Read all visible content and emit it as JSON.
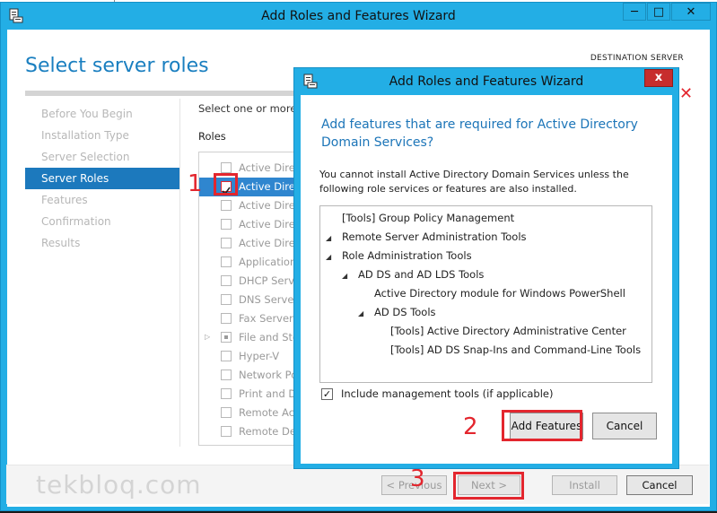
{
  "main_window": {
    "title": "Add Roles and Features Wizard",
    "heading": "Select server roles",
    "destination_label": "DESTINATION SERVER",
    "destination_value": "",
    "nav": [
      {
        "label": "Before You Begin",
        "active": false
      },
      {
        "label": "Installation Type",
        "active": false
      },
      {
        "label": "Server Selection",
        "active": false
      },
      {
        "label": "Server Roles",
        "active": true
      },
      {
        "label": "Features",
        "active": false
      },
      {
        "label": "Confirmation",
        "active": false
      },
      {
        "label": "Results",
        "active": false
      }
    ],
    "roles_intro": "Select one or more r",
    "roles_label": "Roles",
    "roles": [
      {
        "label": "Active Direc",
        "checked": false,
        "selected": false
      },
      {
        "label": "Active Direc",
        "checked": true,
        "selected": true
      },
      {
        "label": "Active Direc",
        "checked": false,
        "selected": false
      },
      {
        "label": "Active Direc",
        "checked": false,
        "selected": false
      },
      {
        "label": "Active Direc",
        "checked": false,
        "selected": false
      },
      {
        "label": "Application",
        "checked": false,
        "selected": false
      },
      {
        "label": "DHCP Serve",
        "checked": false,
        "selected": false
      },
      {
        "label": "DNS Server",
        "checked": false,
        "selected": false
      },
      {
        "label": "Fax Server",
        "checked": false,
        "selected": false
      },
      {
        "label": "File and Sto",
        "checked": false,
        "selected": false,
        "partial": true,
        "expandable": true
      },
      {
        "label": "Hyper-V",
        "checked": false,
        "selected": false
      },
      {
        "label": "Network Po",
        "checked": false,
        "selected": false
      },
      {
        "label": "Print and Do",
        "checked": false,
        "selected": false
      },
      {
        "label": "Remote Acc",
        "checked": false,
        "selected": false
      },
      {
        "label": "Remote Des",
        "checked": false,
        "selected": false
      }
    ],
    "footer": {
      "previous": "< Previous",
      "next": "Next >",
      "install": "Install",
      "cancel": "Cancel"
    }
  },
  "dialog": {
    "title": "Add Roles and Features Wizard",
    "close": "x",
    "heading": "Add features that are required for Active Directory Domain Services?",
    "body": "You cannot install Active Directory Domain Services unless the following role services or features are also installed.",
    "tree": [
      {
        "label": "[Tools] Group Policy Management",
        "depth": 0,
        "expandable": false
      },
      {
        "label": "Remote Server Administration Tools",
        "depth": 0,
        "expandable": true
      },
      {
        "label": "Role Administration Tools",
        "depth": 1,
        "expandable": true
      },
      {
        "label": "AD DS and AD LDS Tools",
        "depth": 2,
        "expandable": true
      },
      {
        "label": "Active Directory module for Windows PowerShell",
        "depth": 3,
        "expandable": false
      },
      {
        "label": "AD DS Tools",
        "depth": 3,
        "expandable": true
      },
      {
        "label": "[Tools] Active Directory Administrative Center",
        "depth": 4,
        "expandable": false
      },
      {
        "label": "[Tools] AD DS Snap-Ins and Command-Line Tools",
        "depth": 4,
        "expandable": false
      }
    ],
    "include_tools_label": "Include management tools (if applicable)",
    "include_tools_checked": true,
    "add_features": "Add Features",
    "cancel": "Cancel"
  },
  "annotations": {
    "one": "1",
    "two": "2",
    "three": "3",
    "color": "#e3262e"
  },
  "watermark": "tekbloq.com",
  "colors": {
    "title_bar": "#23aee5",
    "accent": "#1c79bd",
    "heading": "#1a7fc0"
  }
}
